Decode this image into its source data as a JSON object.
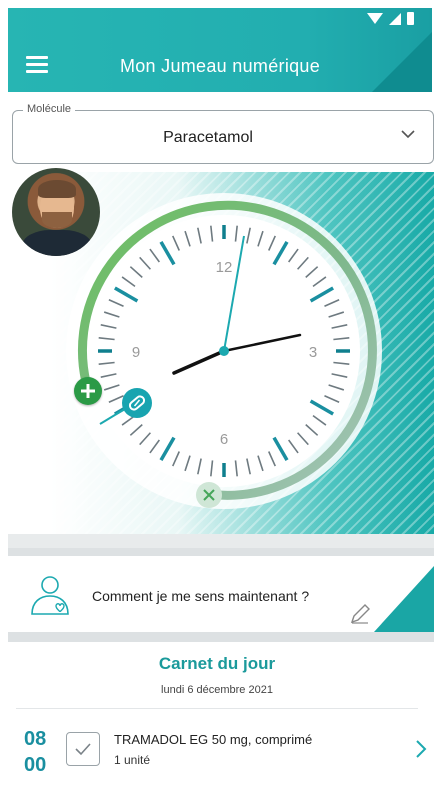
{
  "app": {
    "title": "Mon Jumeau numérique"
  },
  "molecule": {
    "label": "Molécule",
    "value": "Paracetamol"
  },
  "clock": {
    "labels": {
      "twelve": "12",
      "three": "3",
      "six": "6",
      "nine": "9"
    }
  },
  "feeling": {
    "text": "Comment je me sens maintenant ?"
  },
  "carnet": {
    "title": "Carnet du jour",
    "date": "lundi 6 décembre 2021",
    "entries": [
      {
        "hour": "08",
        "minute": "00",
        "name": "TRAMADOL EG 50 mg, comprimé",
        "quantity": "1 unité"
      }
    ]
  },
  "colors": {
    "accent": "#22aeb0",
    "arc_start": "#57b05c",
    "arc_end": "#a8c6bb",
    "add_button": "#2b9a46",
    "pill_marker": "#18a4b0",
    "time_text": "#1a8fa0"
  },
  "icons": [
    "menu-icon",
    "chevron-down-icon",
    "plus-icon",
    "pill-icon",
    "close-icon",
    "person-heart-icon",
    "pencil-icon",
    "checkbox-icon",
    "chevron-right-icon"
  ]
}
